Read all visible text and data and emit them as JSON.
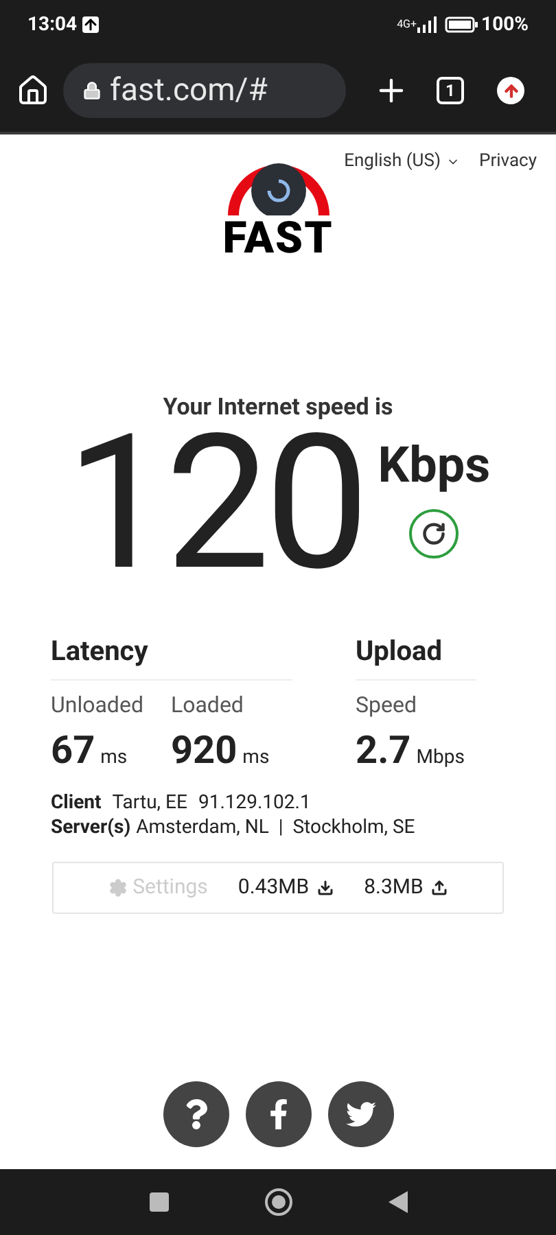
{
  "status_bar": {
    "time": "13:04",
    "network": "4G+",
    "battery": "100%"
  },
  "browser": {
    "url": "fast.com/#",
    "tab_count": "1"
  },
  "header": {
    "language": "English (US)",
    "privacy": "Privacy",
    "logo": "FAST"
  },
  "result": {
    "caption": "Your Internet speed is",
    "speed": "120",
    "unit": "Kbps"
  },
  "latency": {
    "title": "Latency",
    "items": [
      {
        "label": "Unloaded",
        "value": "67",
        "unit": "ms"
      },
      {
        "label": "Loaded",
        "value": "920",
        "unit": "ms"
      }
    ]
  },
  "upload": {
    "title": "Upload",
    "label": "Speed",
    "value": "2.7",
    "unit": "Mbps"
  },
  "client": {
    "label": "Client",
    "location": "Tartu, EE",
    "ip": "91.129.102.1"
  },
  "servers": {
    "label": "Server(s)",
    "list": "Amsterdam, NL  |  Stockholm, SE"
  },
  "footer_bar": {
    "settings": {
      "label": "Settings",
      "disabled": true
    },
    "downloaded": "0.43MB",
    "uploaded": "8.3MB"
  }
}
